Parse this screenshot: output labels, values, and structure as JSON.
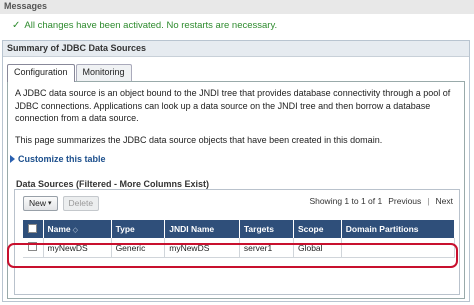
{
  "messages": {
    "header": "Messages",
    "success": "All changes have been activated. No restarts are necessary."
  },
  "summary": {
    "title": "Summary of JDBC Data Sources",
    "tabs": [
      {
        "label": "Configuration",
        "active": true
      },
      {
        "label": "Monitoring",
        "active": false
      }
    ],
    "desc_para1": "A JDBC data source is an object bound to the JNDI tree that provides database connectivity through a pool of JDBC connections. Applications can look up a data source on the JNDI tree and then borrow a database connection from a data source.",
    "desc_para2": "This page summarizes the JDBC data source objects that have been created in this domain.",
    "customize_link": "Customize this table"
  },
  "datasources": {
    "title": "Data Sources (Filtered - More Columns Exist)",
    "new_label": "New",
    "delete_label": "Delete",
    "paging": {
      "showing": "Showing 1 to 1 of 1",
      "previous": "Previous",
      "separator": "|",
      "next": "Next"
    },
    "columns": [
      "Name",
      "Type",
      "JNDI Name",
      "Targets",
      "Scope",
      "Domain Partitions"
    ],
    "rows": [
      [
        "myNewDS",
        "Generic",
        "myNewDS",
        "server1",
        "Global",
        ""
      ]
    ]
  },
  "colors": {
    "header_bg": "#2f4f7a",
    "success": "#2e8b2e",
    "highlight": "#c8102e",
    "link": "#1c4f8c"
  }
}
